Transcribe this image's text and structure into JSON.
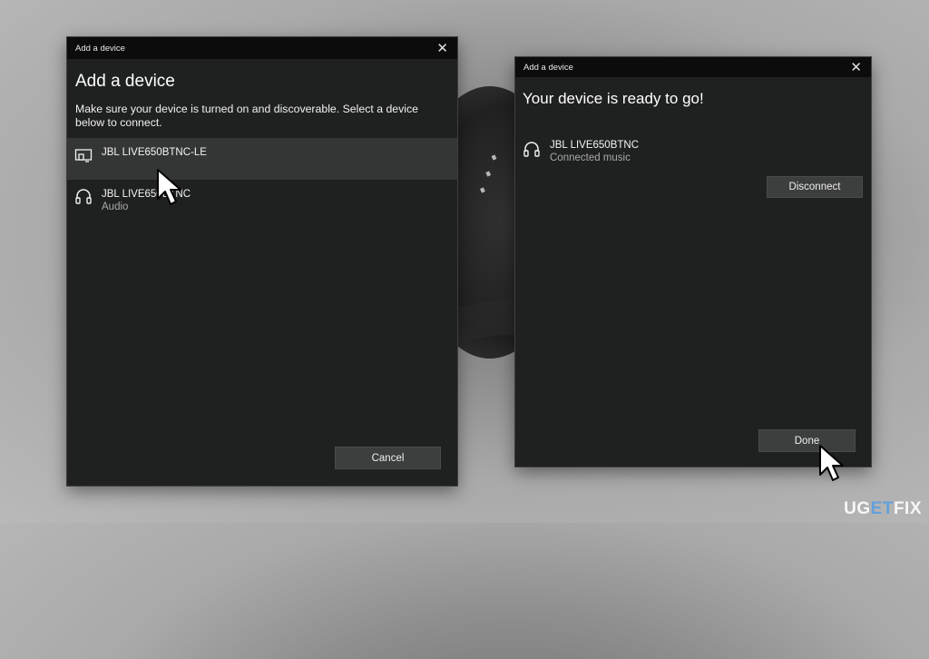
{
  "left_dialog": {
    "titlebar": "Add a device",
    "close_glyph": "✕",
    "heading": "Add a device",
    "instructions": "Make sure your device is turned on and discoverable. Select a device below to connect.",
    "devices": [
      {
        "name": "JBL LIVE650BTNC-LE",
        "subtitle": "",
        "icon": "display-device-icon",
        "selected": true
      },
      {
        "name": "JBL LIVE650BTNC",
        "subtitle": "Audio",
        "icon": "headset-icon",
        "selected": false
      }
    ],
    "cancel_label": "Cancel"
  },
  "right_dialog": {
    "titlebar": "Add a device",
    "close_glyph": "✕",
    "heading": "Your device is ready to go!",
    "device": {
      "name": "JBL LIVE650BTNC",
      "status": "Connected music",
      "icon": "headset-icon"
    },
    "disconnect_label": "Disconnect",
    "done_label": "Done"
  },
  "watermark": {
    "part1": "UG",
    "part2": "ET",
    "part3": "FIX"
  },
  "colors": {
    "dialog_bg": "#1f2120",
    "titlebar_bg": "#0c0c0c",
    "selected_row": "#343635",
    "button_bg": "#3d3e3e"
  }
}
